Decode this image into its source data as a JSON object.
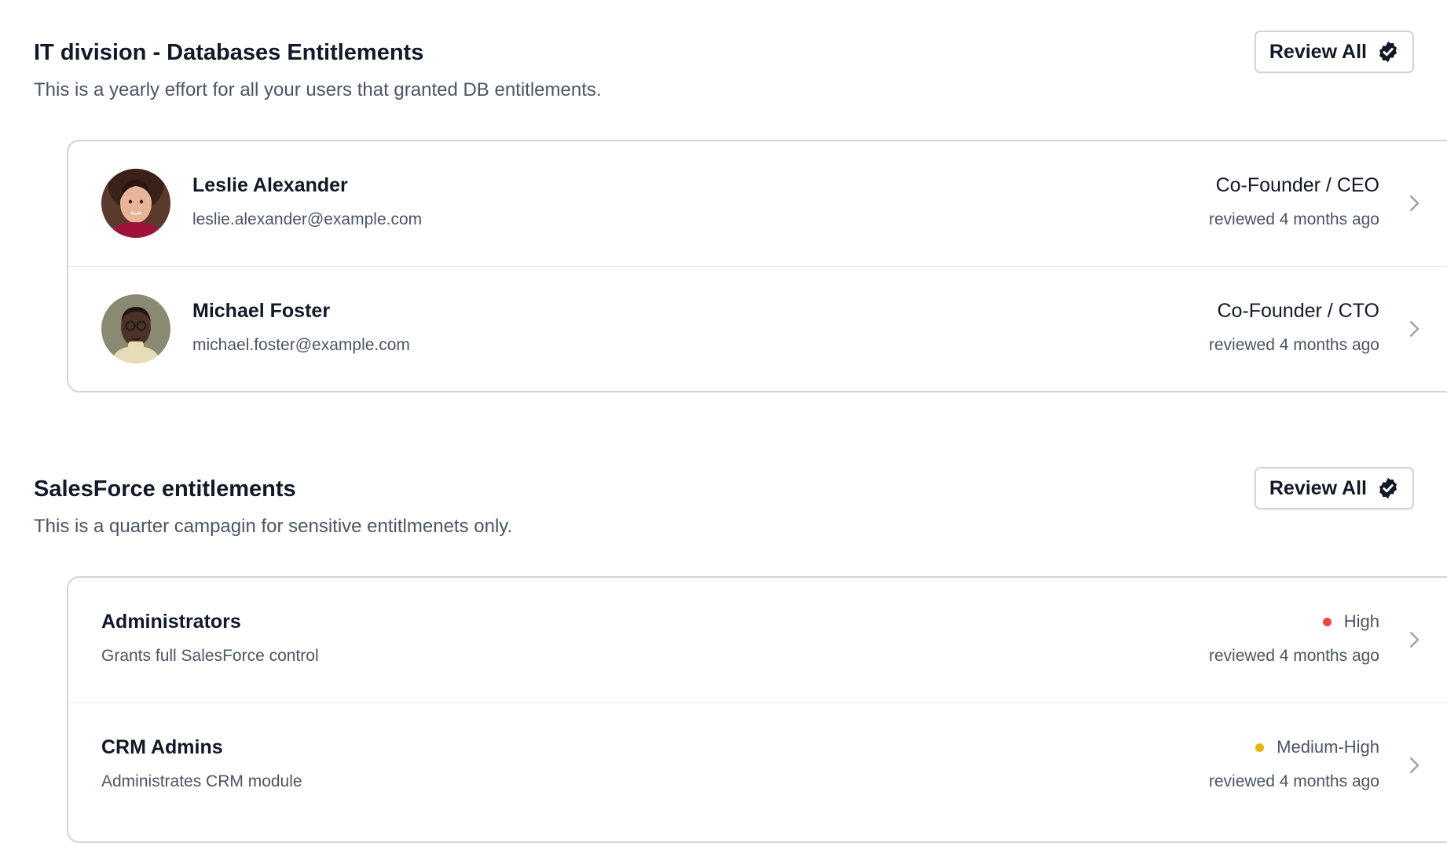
{
  "sections": [
    {
      "title": "IT division - Databases Entitlements",
      "description": "This is a yearly effort for all your users that granted DB entitlements.",
      "review_all_label": "Review All",
      "rows": [
        {
          "name": "Leslie Alexander",
          "email": "leslie.alexander@example.com",
          "role": "Co-Founder / CEO",
          "reviewed": "reviewed 4 months ago"
        },
        {
          "name": "Michael Foster",
          "email": "michael.foster@example.com",
          "role": "Co-Founder / CTO",
          "reviewed": "reviewed 4 months ago"
        }
      ]
    },
    {
      "title": "SalesForce entitlements",
      "description": "This is a quarter campagin for sensitive entitlmenets only.",
      "review_all_label": "Review All",
      "rows": [
        {
          "name": "Administrators",
          "detail": "Grants full SalesForce control",
          "risk": "High",
          "risk_color": "#ef4444",
          "reviewed": "reviewed 4 months ago"
        },
        {
          "name": "CRM Admins",
          "detail": "Administrates CRM module",
          "risk": "Medium-High",
          "risk_color": "#eab308",
          "reviewed": "reviewed 4 months ago"
        }
      ]
    }
  ],
  "icons": {
    "review_all": "badge-check-icon",
    "row_action": "chevron-right-icon",
    "avatar": "avatar"
  },
  "colors": {
    "text_primary": "#111827",
    "text_secondary": "#4b5563",
    "border": "#d1d5db",
    "divider": "#e5e7eb"
  }
}
